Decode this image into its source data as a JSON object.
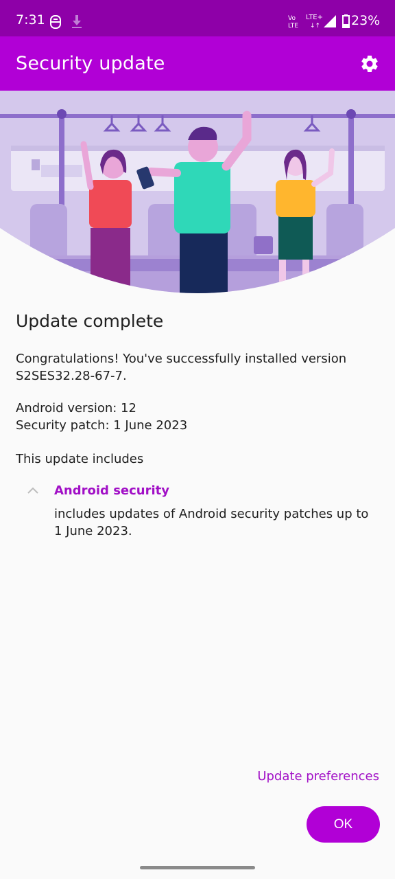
{
  "status_bar": {
    "time": "7:31",
    "notification_icons": [
      "s-logo-icon",
      "download-icon"
    ],
    "network": [
      "VoLTE",
      "LTE+"
    ],
    "battery": "23%"
  },
  "app_bar": {
    "title": "Security update",
    "settings_icon": "gear-icon"
  },
  "hero": {
    "illustration": "people-on-train-illustration"
  },
  "main": {
    "heading": "Update complete",
    "congrats_text": "Congratulations! You've successfully installed version S2SES32.28-67-7.",
    "android_version": "Android version: 12",
    "security_patch": "Security patch: 1 June 2023",
    "includes_label": "This update includes",
    "section": {
      "title": "Android security",
      "description": "includes updates of Android security patches up to 1 June 2023.",
      "expanded": true
    }
  },
  "actions": {
    "preferences_label": "Update preferences",
    "ok_label": "OK"
  },
  "colors": {
    "status_bar": "#8e00a8",
    "app_bar": "#b100d6",
    "accent": "#a10fc6"
  }
}
